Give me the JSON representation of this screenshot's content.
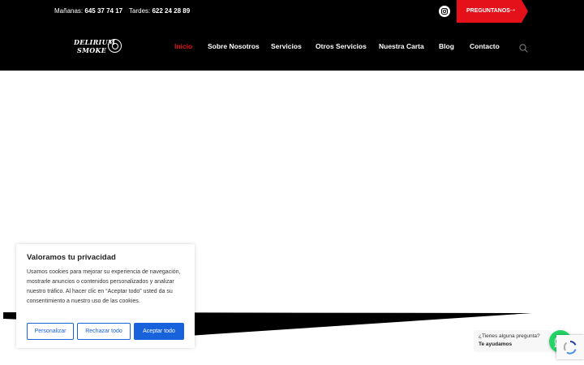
{
  "topbar": {
    "morning_label": "Mañanas:",
    "morning_phone": "645 37 74 17",
    "evening_label": "Tardes:",
    "evening_phone": "622 24 28 89",
    "cta_label": "PREGUNTANOS",
    "cta_icon": "arrow-right-icon",
    "social_icon": "instagram-icon"
  },
  "header": {
    "logo_line1": "DELIRIUM",
    "logo_line2": "SMOKE",
    "nav": [
      {
        "label": "Inicio",
        "active": true
      },
      {
        "label": "Sobre Nosotros",
        "active": false
      },
      {
        "label": "Servicios",
        "active": false
      },
      {
        "label": "Otros Servicios",
        "active": false
      },
      {
        "label": "Nuestra Carta",
        "active": false
      },
      {
        "label": "Blog",
        "active": false
      },
      {
        "label": "Contacto",
        "active": false
      }
    ],
    "search_icon": "search-icon"
  },
  "cookie_banner": {
    "title": "Valoramos tu privacidad",
    "text": "Usamos cookies para mejorar su experiencia de navegación, mostrarle anuncios o contenidos personalizados y analizar nuestro tráfico. Al hacer clic en “Aceptar todo” usted da su consentimiento a nuestro uso de las cookies.",
    "customize_label": "Personalizar",
    "reject_label": "Rechazar todo",
    "accept_label": "Aceptar todo"
  },
  "whatsapp": {
    "question": "¿Tienes alguna pregunta?",
    "answer": "Te ayudamos",
    "icon": "whatsapp-icon"
  },
  "colors": {
    "accent_red": "#e4111b",
    "cookie_blue": "#1863dc",
    "whatsapp_green": "#25d366",
    "header_black": "#000000"
  }
}
